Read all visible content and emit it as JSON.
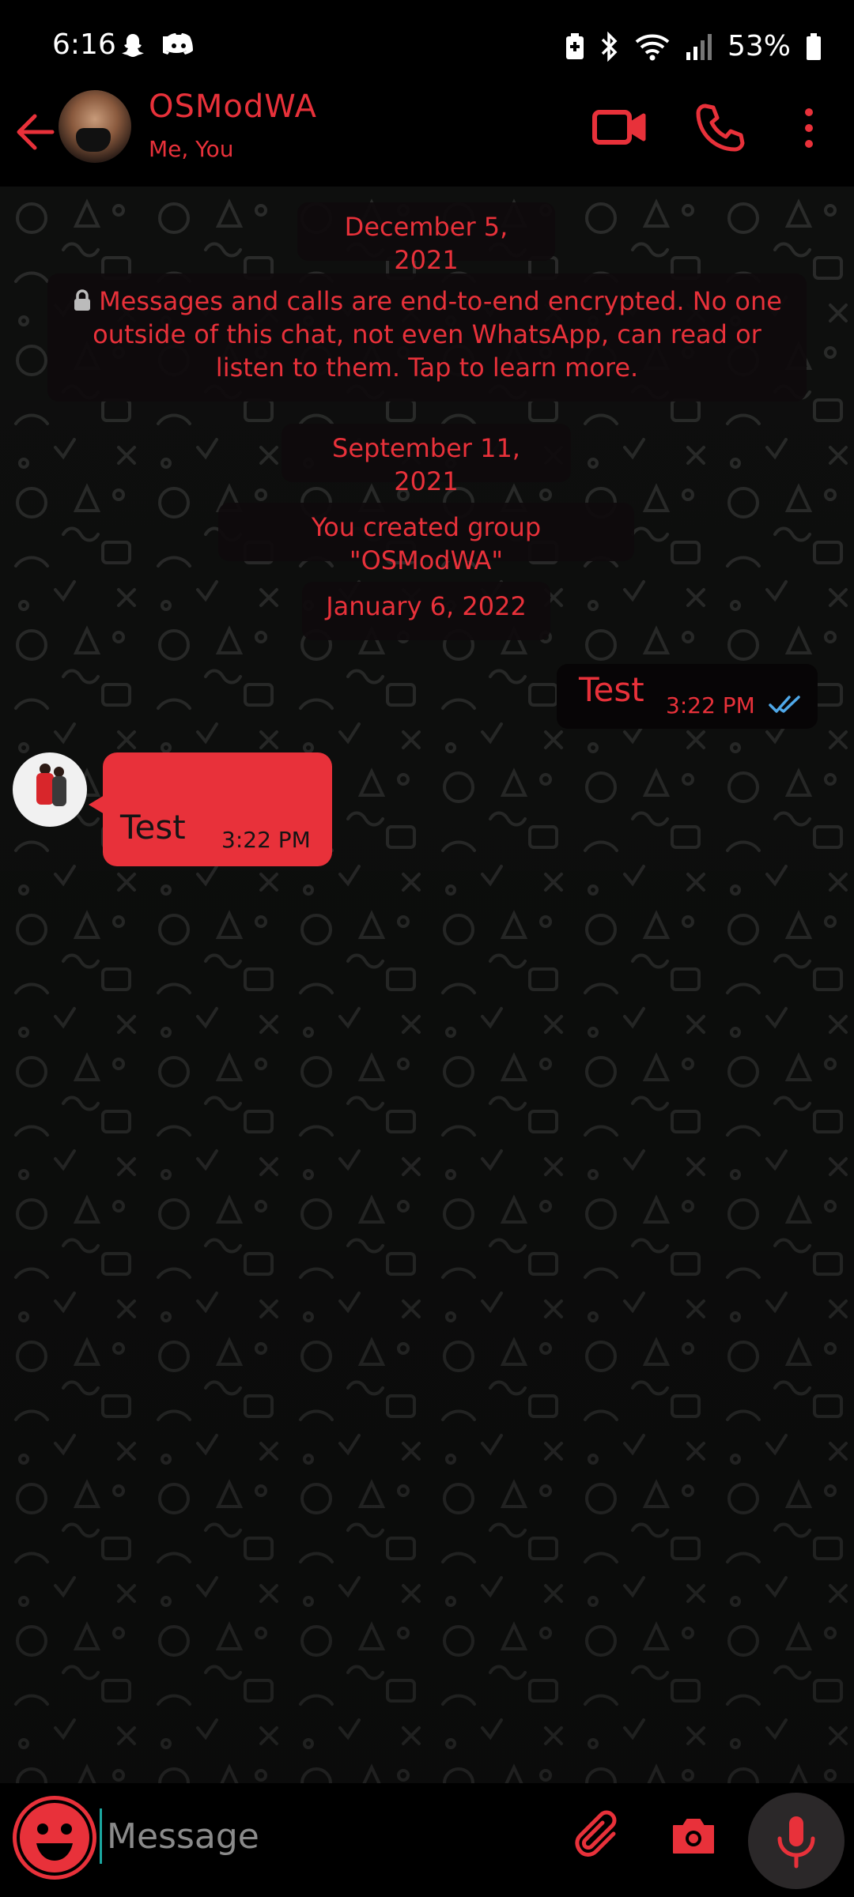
{
  "status_bar": {
    "time": "6:16",
    "battery": "53%"
  },
  "header": {
    "title": "OSModWA",
    "subtitle": "Me, You"
  },
  "chat": {
    "date_1": "December 5, 2021",
    "encryption_notice": "Messages and calls are end-to-end encrypted. No one outside of this chat, not even WhatsApp, can read or listen to them. Tap to learn more.",
    "date_2": "September 11, 2021",
    "system_message": "You created group \"OSModWA\"",
    "date_3": "January 6, 2022",
    "outgoing": {
      "text": "Test",
      "time": "3:22 PM"
    },
    "incoming": {
      "text": "Test",
      "time": "3:22 PM"
    }
  },
  "input": {
    "placeholder": "Message"
  },
  "colors": {
    "accent": "#e8313a",
    "background": "#000000",
    "tick_blue": "#4fa8e8"
  },
  "icons": [
    "back-arrow-icon",
    "video-call-icon",
    "phone-icon",
    "more-vert-icon",
    "lock-icon",
    "double-check-icon",
    "emoji-icon",
    "attach-icon",
    "camera-icon",
    "mic-icon"
  ]
}
